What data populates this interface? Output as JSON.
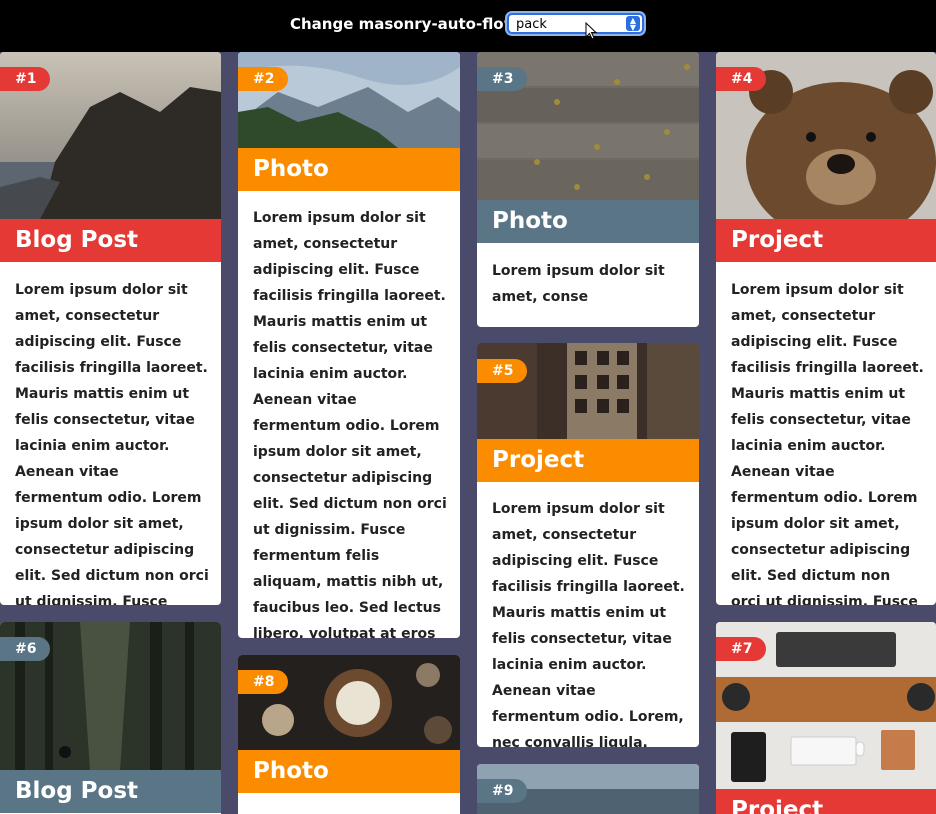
{
  "toolbar": {
    "label": "Change masonry-auto-flow:",
    "select_value": "pack",
    "select_options": [
      "pack"
    ]
  },
  "colors": {
    "red": "#e53935",
    "orange": "#fb8c00",
    "slate": "#5a7585"
  },
  "cards": [
    {
      "num": "#1",
      "kind": "Blog Post",
      "color": "red",
      "text": "Lorem ipsum dolor sit amet, consectetur adipiscing elit. Fusce facilisis fringilla laoreet. Mauris mattis enim ut felis consectetur, vitae lacinia enim auctor. Aenean vitae fermentum odio. Lorem ipsum dolor sit amet, consectetur adipiscing elit. Sed dictum non orci ut dignissim. Fusce fermentum fr."
    },
    {
      "num": "#2",
      "kind": "Photo",
      "color": "orange",
      "text": "Lorem ipsum dolor sit amet, consectetur adipiscing elit. Fusce facilisis fringilla laoreet. Mauris mattis enim ut felis consectetur, vitae lacinia enim auctor. Aenean vitae fermentum odio. Lorem ipsum dolor sit amet, consectetur adipiscing elit. Sed dictum non orci ut dignissim. Fusce fermentum felis aliquam, mattis nibh ut, faucibus leo. Sed lectus libero, volutpat at eros quis, venenatis tempus neque. Nulla vel ."
    },
    {
      "num": "#3",
      "kind": "Photo",
      "color": "slate",
      "text": "Lorem ipsum dolor sit amet, conse"
    },
    {
      "num": "#4",
      "kind": "Project",
      "color": "red",
      "text": "Lorem ipsum dolor sit amet, consectetur adipiscing elit. Fusce facilisis fringilla laoreet. Mauris mattis enim ut felis consectetur, vitae lacinia enim auctor. Aenean vitae fermentum odio. Lorem ipsum dolor sit amet, consectetur adipiscing elit. Sed dictum non orci ut dignissim. Fusce fermentum felis a."
    },
    {
      "num": "#5",
      "kind": "Project",
      "color": "orange",
      "text": "Lorem ipsum dolor sit amet, consectetur adipiscing elit. Fusce facilisis fringilla laoreet. Mauris mattis enim ut felis consectetur, vitae lacinia enim auctor. Aenean vitae fermentum odio. Lorem, nec convallis ligula. Quisque maximus"
    },
    {
      "num": "#6",
      "kind": "Blog Post",
      "color": "slate",
      "text": ""
    },
    {
      "num": "#7",
      "kind": "Project",
      "color": "red",
      "text": ""
    },
    {
      "num": "#8",
      "kind": "Photo",
      "color": "orange",
      "text": ""
    },
    {
      "num": "#9",
      "kind": "",
      "color": "slate",
      "text": ""
    }
  ]
}
